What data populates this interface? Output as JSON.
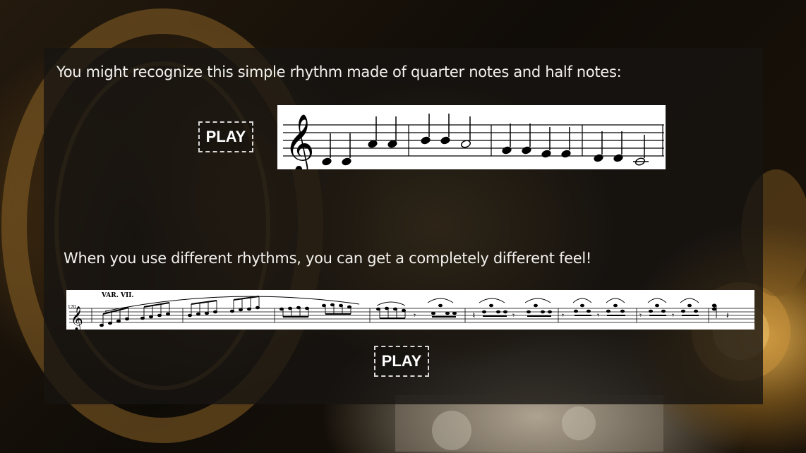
{
  "section1": {
    "text": "You might recognize this simple rhythm made of quarter notes and half notes:",
    "play_label": "PLAY"
  },
  "section2": {
    "text": "When you use different rhythms, you can get a completely different feel!",
    "play_label": "PLAY",
    "score_heading": "VAR. VII.",
    "measure_number": "170"
  },
  "icons": {
    "clef": "treble-clef-icon"
  }
}
